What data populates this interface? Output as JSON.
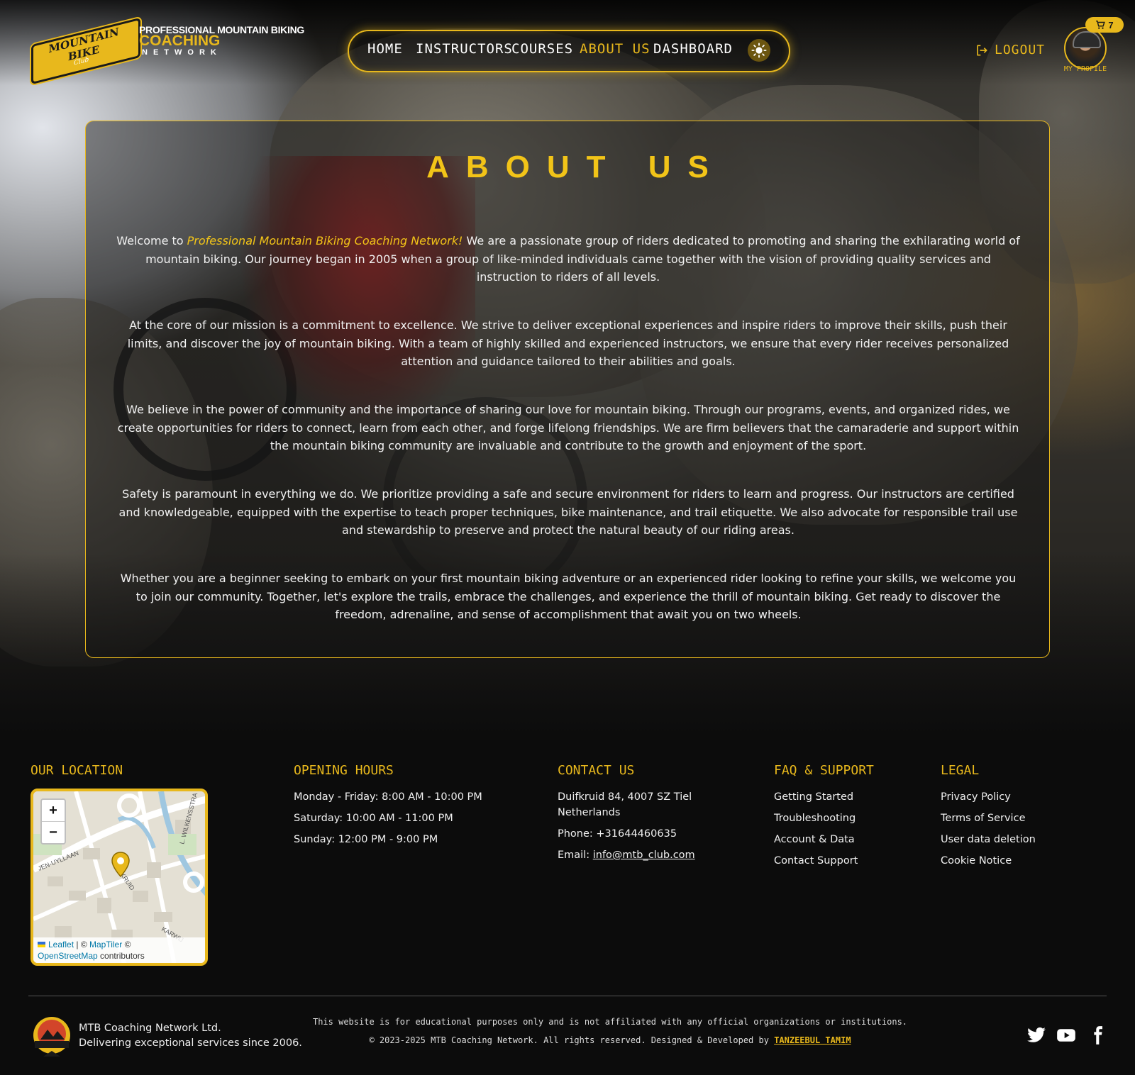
{
  "brand": {
    "badge_text": "MOUNTAIN BIKE",
    "badge_sub": "Club",
    "line1": "PROFESSIONAL MOUNTAIN BIKING",
    "line2": "COACHING",
    "line3": "NETWORK",
    "accent_color": "#e8b81c"
  },
  "nav": {
    "items": [
      {
        "label": "HOME",
        "active": false
      },
      {
        "label": "INSTRUCTORS",
        "active": false
      },
      {
        "label": "COURSES",
        "active": false
      },
      {
        "label": "ABOUT US",
        "active": true
      },
      {
        "label": "DASHBOARD",
        "active": false
      }
    ],
    "theme_toggle_icon": "sun-icon",
    "logout_label": "LOGOUT",
    "cart_count": "7",
    "profile_label": "MY PROFILE"
  },
  "about": {
    "title": "ABOUT US",
    "p1_pre": "Welcome to ",
    "p1_em": "Professional Mountain Biking Coaching Network!",
    "p1_post": " We are a passionate group of riders dedicated to promoting and sharing the exhilarating world of mountain biking. Our journey began in 2005 when a group of like-minded individuals came together with the vision of providing quality services and instruction to riders of all levels.",
    "p2": "At the core of our mission is a commitment to excellence. We strive to deliver exceptional experiences and inspire riders to improve their skills, push their limits, and discover the joy of mountain biking. With a team of highly skilled and experienced instructors, we ensure that every rider receives personalized attention and guidance tailored to their abilities and goals.",
    "p3": "We believe in the power of community and the importance of sharing our love for mountain biking. Through our programs, events, and organized rides, we create opportunities for riders to connect, learn from each other, and forge lifelong friendships. We are firm believers that the camaraderie and support within the mountain biking community are invaluable and contribute to the growth and enjoyment of the sport.",
    "p4": "Safety is paramount in everything we do. We prioritize providing a safe and secure environment for riders to learn and progress. Our instructors are certified and knowledgeable, equipped with the expertise to teach proper techniques, bike maintenance, and trail etiquette. We also advocate for responsible trail use and stewardship to preserve and protect the natural beauty of our riding areas.",
    "p5": "Whether you are a beginner seeking to embark on your first mountain biking adventure or an experienced rider looking to refine your skills, we welcome you to join our community. Together, let's explore the trails, embrace the challenges, and experience the thrill of mountain biking. Get ready to discover the freedom, adrenaline, and sense of accomplishment that await you on two wheels."
  },
  "footer": {
    "location": {
      "heading": "OUR LOCATION",
      "zoom_in": "+",
      "zoom_out": "−",
      "attrib_leaflet": "Leaflet",
      "attrib_sep": " | © ",
      "attrib_maptiler": "MapTiler",
      "attrib_copy": " ©",
      "attrib_osm": "OpenStreetMap",
      "attrib_contrib": " contributors",
      "street1": "JEN-UYLLAAN",
      "street2": "L. WILKENSSTRA",
      "street3": "DUIFKRUID",
      "street4": "KARWIJ"
    },
    "hours": {
      "heading": "OPENING HOURS",
      "lines": [
        "Monday - Friday: 8:00 AM - 10:00 PM",
        "Saturday: 10:00 AM - 11:00 PM",
        "Sunday: 12:00 PM - 9:00 PM"
      ]
    },
    "contact": {
      "heading": "CONTACT US",
      "address1": "Duifkruid 84, 4007 SZ Tiel",
      "address2": "Netherlands",
      "phone": "Phone: +31644460635",
      "email_label": "Email: ",
      "email": "info@mtb_club.com"
    },
    "faq": {
      "heading": "FAQ & SUPPORT",
      "links": [
        "Getting Started",
        "Troubleshooting",
        "Account & Data",
        "Contact Support"
      ]
    },
    "legal": {
      "heading": "LEGAL",
      "links": [
        "Privacy Policy",
        "Terms of Service",
        "User data deletion",
        "Cookie Notice"
      ]
    },
    "company_name": "MTB Coaching Network Ltd.",
    "company_tagline": "Delivering exceptional services since 2006.",
    "disclaimer": "This website is for educational purposes only and is not affiliated with any official organizations or institutions.",
    "copyright_pre": "© 2023-2025 MTB Coaching Network. All rights reserved. Designed & Developed by ",
    "developer": "TANZEEBUL TAMIM",
    "social": [
      "twitter-icon",
      "youtube-icon",
      "facebook-icon"
    ]
  }
}
